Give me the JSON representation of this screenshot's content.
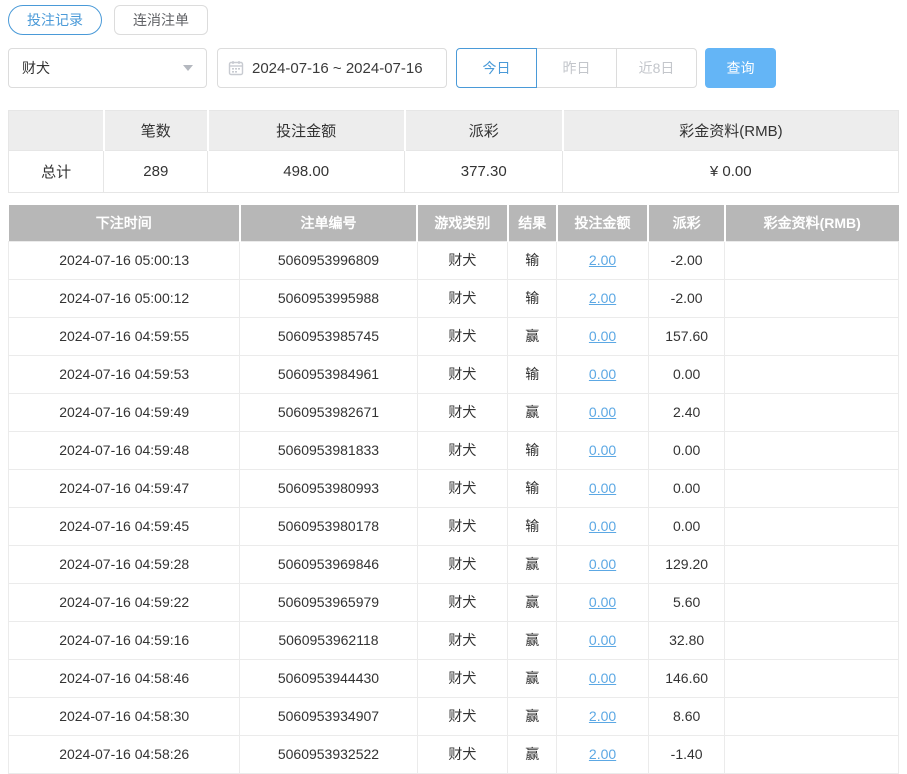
{
  "colors": {
    "accent_blue": "#4a9ad8",
    "query_button_blue": "#64b5f6",
    "link_blue": "#5ca8e4",
    "negative_red": "#e25c5c",
    "table_header_gray": "#b7b7b7",
    "summary_header_gray": "#ededed"
  },
  "tabs": [
    {
      "label": "投注记录",
      "active": true
    },
    {
      "label": "连消注单",
      "active": false
    }
  ],
  "filters": {
    "game_select": {
      "value": "财犬"
    },
    "date_range": {
      "value": "2024-07-16 ~ 2024-07-16"
    },
    "quick_ranges": [
      {
        "label": "今日",
        "active": true
      },
      {
        "label": "昨日",
        "active": false
      },
      {
        "label": "近8日",
        "active": false
      }
    ],
    "query_label": "查询"
  },
  "summary": {
    "headers": [
      "",
      "笔数",
      "投注金额",
      "派彩",
      "彩金资料(RMB)"
    ],
    "total": {
      "label": "总计",
      "count": "289",
      "bet_amount": "498.00",
      "payout": "377.30",
      "bonus": "¥ 0.00"
    }
  },
  "table": {
    "headers": [
      "下注时间",
      "注单编号",
      "游戏类别",
      "结果",
      "投注金额",
      "派彩",
      "彩金资料(RMB)"
    ],
    "rows": [
      {
        "time": "2024-07-16 05:00:13",
        "order_no": "5060953996809",
        "game": "财犬",
        "result": "输",
        "bet": "2.00",
        "payout": "-2.00",
        "bonus": ""
      },
      {
        "time": "2024-07-16 05:00:12",
        "order_no": "5060953995988",
        "game": "财犬",
        "result": "输",
        "bet": "2.00",
        "payout": "-2.00",
        "bonus": ""
      },
      {
        "time": "2024-07-16 04:59:55",
        "order_no": "5060953985745",
        "game": "财犬",
        "result": "赢",
        "bet": "0.00",
        "payout": "157.60",
        "bonus": ""
      },
      {
        "time": "2024-07-16 04:59:53",
        "order_no": "5060953984961",
        "game": "财犬",
        "result": "输",
        "bet": "0.00",
        "payout": "0.00",
        "bonus": ""
      },
      {
        "time": "2024-07-16 04:59:49",
        "order_no": "5060953982671",
        "game": "财犬",
        "result": "赢",
        "bet": "0.00",
        "payout": "2.40",
        "bonus": ""
      },
      {
        "time": "2024-07-16 04:59:48",
        "order_no": "5060953981833",
        "game": "财犬",
        "result": "输",
        "bet": "0.00",
        "payout": "0.00",
        "bonus": ""
      },
      {
        "time": "2024-07-16 04:59:47",
        "order_no": "5060953980993",
        "game": "财犬",
        "result": "输",
        "bet": "0.00",
        "payout": "0.00",
        "bonus": ""
      },
      {
        "time": "2024-07-16 04:59:45",
        "order_no": "5060953980178",
        "game": "财犬",
        "result": "输",
        "bet": "0.00",
        "payout": "0.00",
        "bonus": ""
      },
      {
        "time": "2024-07-16 04:59:28",
        "order_no": "5060953969846",
        "game": "财犬",
        "result": "赢",
        "bet": "0.00",
        "payout": "129.20",
        "bonus": ""
      },
      {
        "time": "2024-07-16 04:59:22",
        "order_no": "5060953965979",
        "game": "财犬",
        "result": "赢",
        "bet": "0.00",
        "payout": "5.60",
        "bonus": ""
      },
      {
        "time": "2024-07-16 04:59:16",
        "order_no": "5060953962118",
        "game": "财犬",
        "result": "赢",
        "bet": "0.00",
        "payout": "32.80",
        "bonus": ""
      },
      {
        "time": "2024-07-16 04:58:46",
        "order_no": "5060953944430",
        "game": "财犬",
        "result": "赢",
        "bet": "0.00",
        "payout": "146.60",
        "bonus": ""
      },
      {
        "time": "2024-07-16 04:58:30",
        "order_no": "5060953934907",
        "game": "财犬",
        "result": "赢",
        "bet": "2.00",
        "payout": "8.60",
        "bonus": ""
      },
      {
        "time": "2024-07-16 04:58:26",
        "order_no": "5060953932522",
        "game": "财犬",
        "result": "赢",
        "bet": "2.00",
        "payout": "-1.40",
        "bonus": ""
      }
    ]
  }
}
